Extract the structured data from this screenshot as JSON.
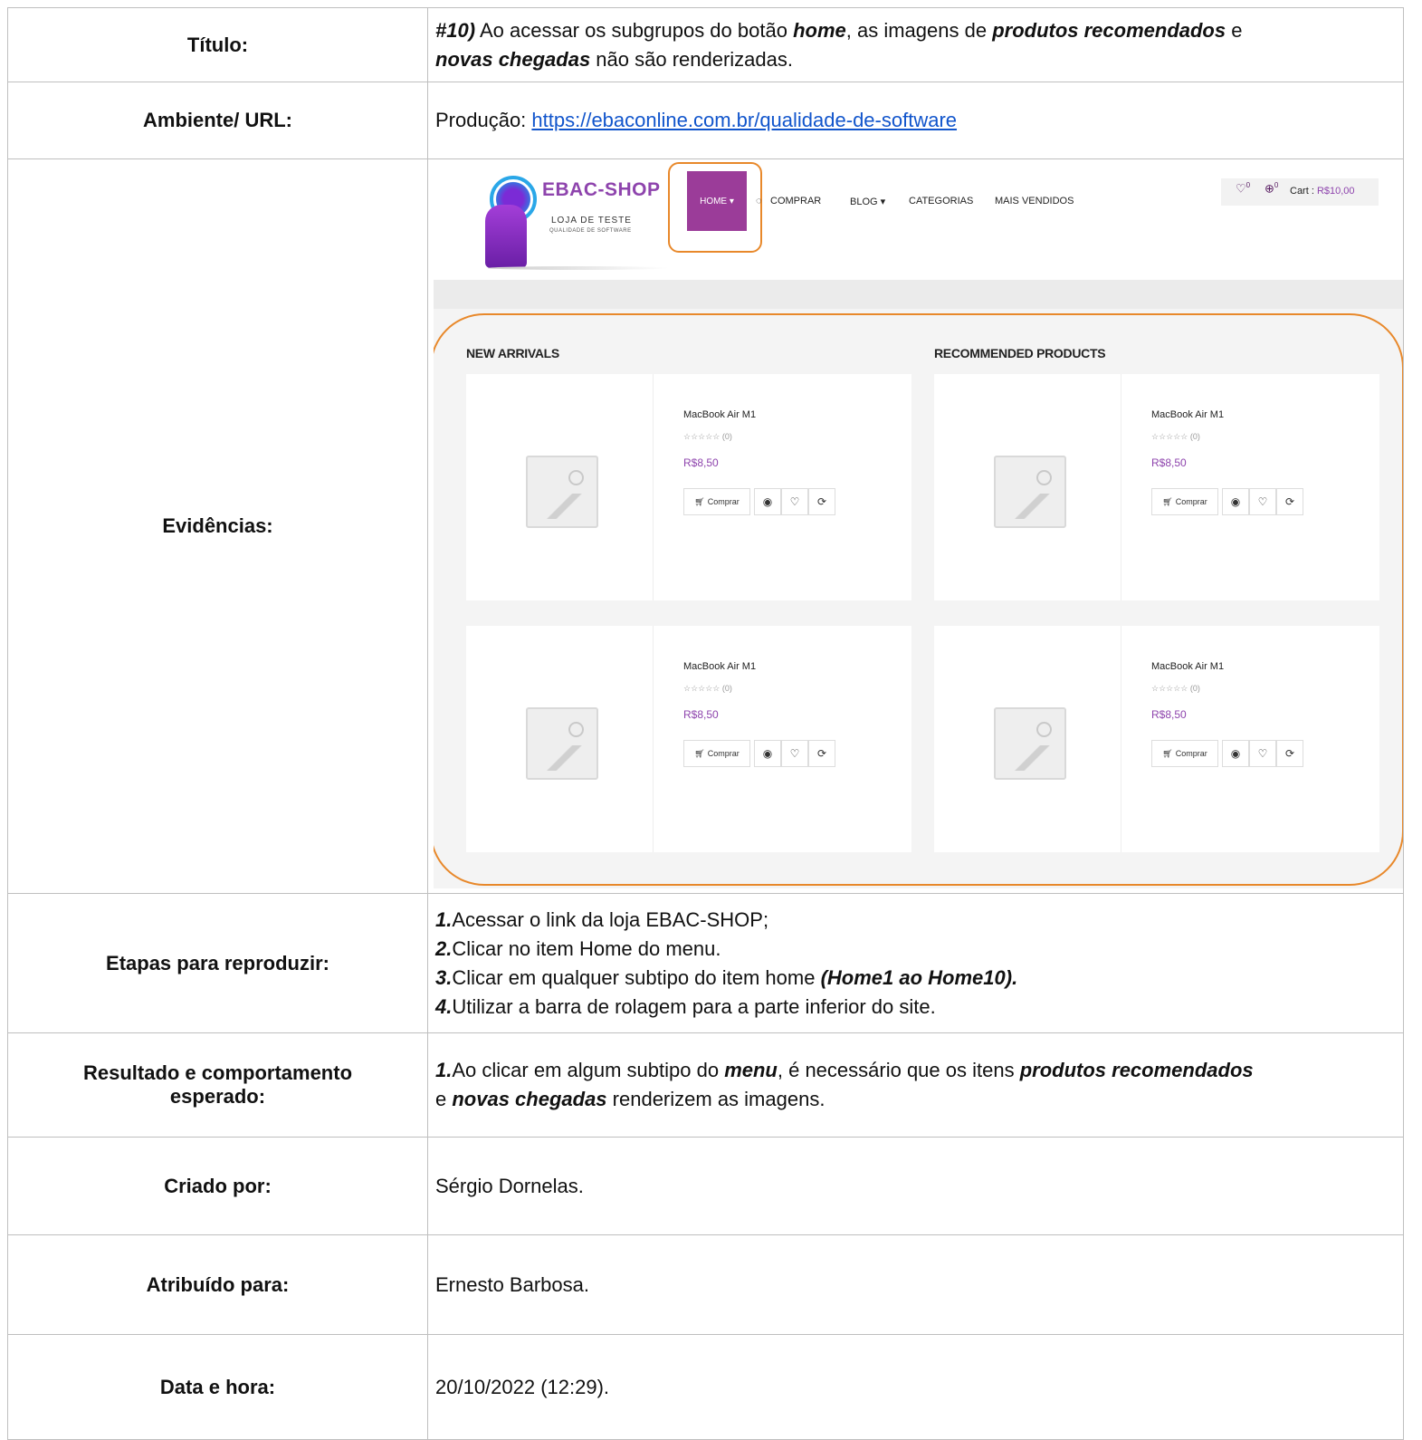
{
  "rows": {
    "titulo": {
      "label": "Título:",
      "p1": "#10)",
      "p2": " Ao acessar os subgrupos do botão ",
      "p3": "home",
      "p4": ", as imagens de ",
      "p5": "produtos recomendados",
      "p6": " e",
      "p7": "novas chegadas",
      "p8": " não são renderizadas."
    },
    "ambiente": {
      "label": "Ambiente/ URL:",
      "prefix": "Produção: ",
      "url": "https://ebaconline.com.br/qualidade-de-software"
    },
    "evidencias": {
      "label": "Evidências:"
    },
    "etapas": {
      "label": "Etapas para reproduzir:",
      "s1n": "1.",
      "s1": "Acessar o link da loja EBAC-SHOP;",
      "s2n": "2.",
      "s2": "Clicar no item Home do menu.",
      "s3n": "3.",
      "s3": "Clicar em qualquer subtipo do item home ",
      "s3b": "(Home1 ao Home10).",
      "s4n": "4.",
      "s4": "Utilizar a barra de rolagem para a parte inferior do site."
    },
    "resultado": {
      "label1": "Resultado e comportamento",
      "label2": "esperado:",
      "p1": "1.",
      "p2": "Ao clicar em algum subtipo do ",
      "p3": "menu",
      "p4": ", é necessário que os itens ",
      "p5": "produtos recomendados",
      "p6": "e ",
      "p7": "novas chegadas",
      "p8": " renderizem as imagens."
    },
    "criado": {
      "label": "Criado por:",
      "value": "Sérgio Dornelas."
    },
    "atribuido": {
      "label": "Atribuído para:",
      "value": "Ernesto Barbosa."
    },
    "data": {
      "label": "Data e hora:",
      "value": " 20/10/2022 (12:29)."
    }
  },
  "shop": {
    "brand": "EBAC-SHOP",
    "brand_sub": "LOJA DE TESTE",
    "brand_sub2": "QUALIDADE DE SOFTWARE",
    "home": "HOME ▾",
    "nav": [
      "COMPRAR",
      "BLOG ▾",
      "CATEGORIAS",
      "MAIS VENDIDOS"
    ],
    "wish_count": "0",
    "cart_count": "0",
    "cart_label": "Cart : ",
    "cart_value": "R$10,00",
    "new_arrivals": "NEW ARRIVALS",
    "recommended": "RECOMMENDED PRODUCTS",
    "product": {
      "name": "MacBook Air M1",
      "stars": "☆☆☆☆☆ (0)",
      "price": "R$8,50",
      "buy": "Comprar"
    }
  },
  "colors": {
    "accent_orange": "#e8882a",
    "brand_purple": "#8e44ad",
    "link_blue": "#1155cc"
  }
}
